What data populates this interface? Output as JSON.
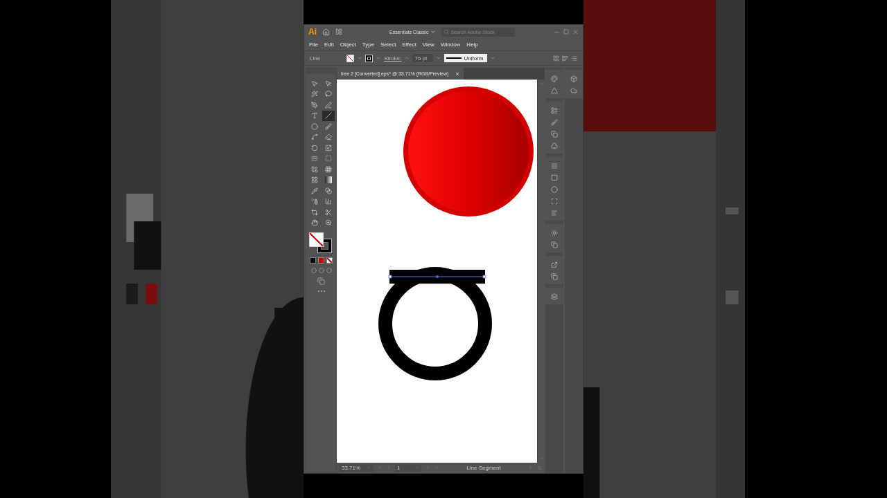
{
  "title_bar": {
    "logo": "Ai",
    "workspace": "Essentials Classic",
    "search": {
      "placeholder": "Search Adobe Stock"
    }
  },
  "menu": [
    "File",
    "Edit",
    "Object",
    "Type",
    "Select",
    "Effect",
    "View",
    "Window",
    "Help"
  ],
  "control_bar": {
    "selection": "Line",
    "stroke_label": "Stroke:",
    "stroke_weight": "75 pt",
    "profile": "Uniform"
  },
  "tools": [
    {
      "kind": "selection",
      "selected": false
    },
    {
      "kind": "direct",
      "selected": false
    },
    {
      "kind": "wand",
      "selected": false
    },
    {
      "kind": "lasso",
      "selected": false
    },
    {
      "kind": "pen",
      "selected": false
    },
    {
      "kind": "curvature",
      "selected": false
    },
    {
      "kind": "type",
      "selected": false
    },
    {
      "kind": "line",
      "selected": true
    },
    {
      "kind": "ellipse",
      "selected": false
    },
    {
      "kind": "brush",
      "selected": false
    },
    {
      "kind": "shaper",
      "selected": false
    },
    {
      "kind": "eraser",
      "selected": false
    },
    {
      "kind": "rotate",
      "selected": false
    },
    {
      "kind": "scale",
      "selected": false
    },
    {
      "kind": "warp",
      "selected": false
    },
    {
      "kind": "transform",
      "selected": false
    },
    {
      "kind": "builder",
      "selected": false
    },
    {
      "kind": "perspective",
      "selected": false
    },
    {
      "kind": "mesh",
      "selected": false
    },
    {
      "kind": "gradient",
      "selected": false
    },
    {
      "kind": "eyedropper",
      "selected": false
    },
    {
      "kind": "blend",
      "selected": false
    },
    {
      "kind": "symbol",
      "selected": false
    },
    {
      "kind": "graph",
      "selected": false
    },
    {
      "kind": "artboard",
      "selected": false
    },
    {
      "kind": "slice",
      "selected": false
    },
    {
      "kind": "hand",
      "selected": false
    },
    {
      "kind": "zoom",
      "selected": false
    }
  ],
  "document_tab": {
    "title": "tree 2 [Converted].eps* @ 33.71% (RGB/Preview)",
    "close": "×"
  },
  "status_bar": {
    "zoom": "33.71%",
    "artboard": "1",
    "status": "Line Segment"
  }
}
